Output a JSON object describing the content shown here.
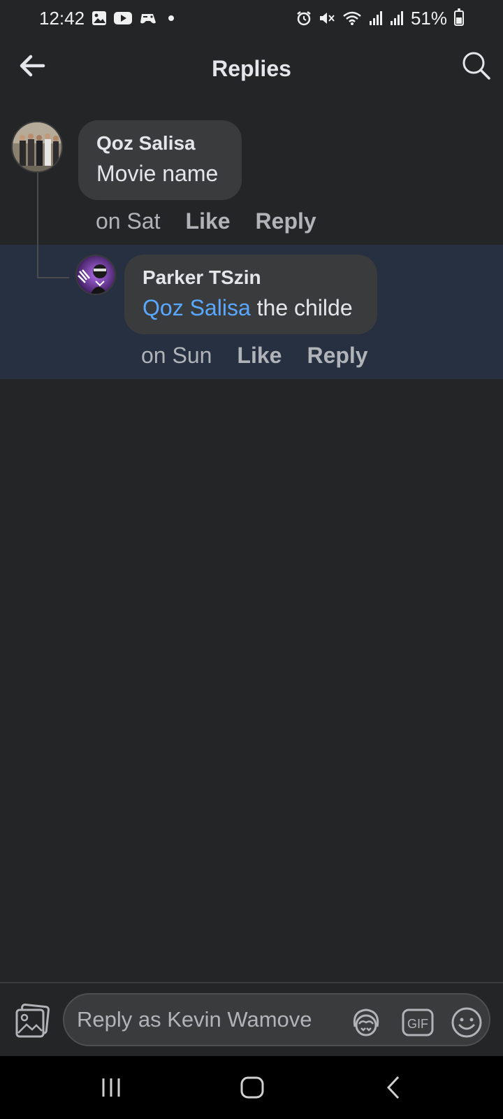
{
  "status_bar": {
    "time": "12:42",
    "battery": "51%",
    "icons": [
      "gallery-icon",
      "youtube-icon",
      "game-icon",
      "dot-icon",
      "alarm-icon",
      "mute-icon",
      "wifi-icon",
      "signal-icon",
      "signal-icon",
      "battery-icon"
    ]
  },
  "header": {
    "title": "Replies",
    "icons": [
      "back-arrow-icon",
      "search-icon"
    ]
  },
  "comments": [
    {
      "author": "Qoz Salisa",
      "text": "Movie name",
      "time": "on Sat",
      "like": "Like",
      "reply": "Reply"
    },
    {
      "author": "Parker TSzin",
      "mention": "Qoz Salisa",
      "text": " the childe",
      "time": "on Sun",
      "like": "Like",
      "reply": "Reply"
    }
  ],
  "composer": {
    "placeholder": "Reply as Kevin Wamove",
    "gif_label": "GIF",
    "icons": [
      "photo-icon",
      "avatar-sticker-icon",
      "gif-icon",
      "emoji-icon"
    ]
  },
  "colors": {
    "background": "#242526",
    "bubble": "#3a3b3c",
    "highlight": "#263040",
    "mention": "#5aa7ff",
    "secondary_text": "#b0b3b8"
  }
}
